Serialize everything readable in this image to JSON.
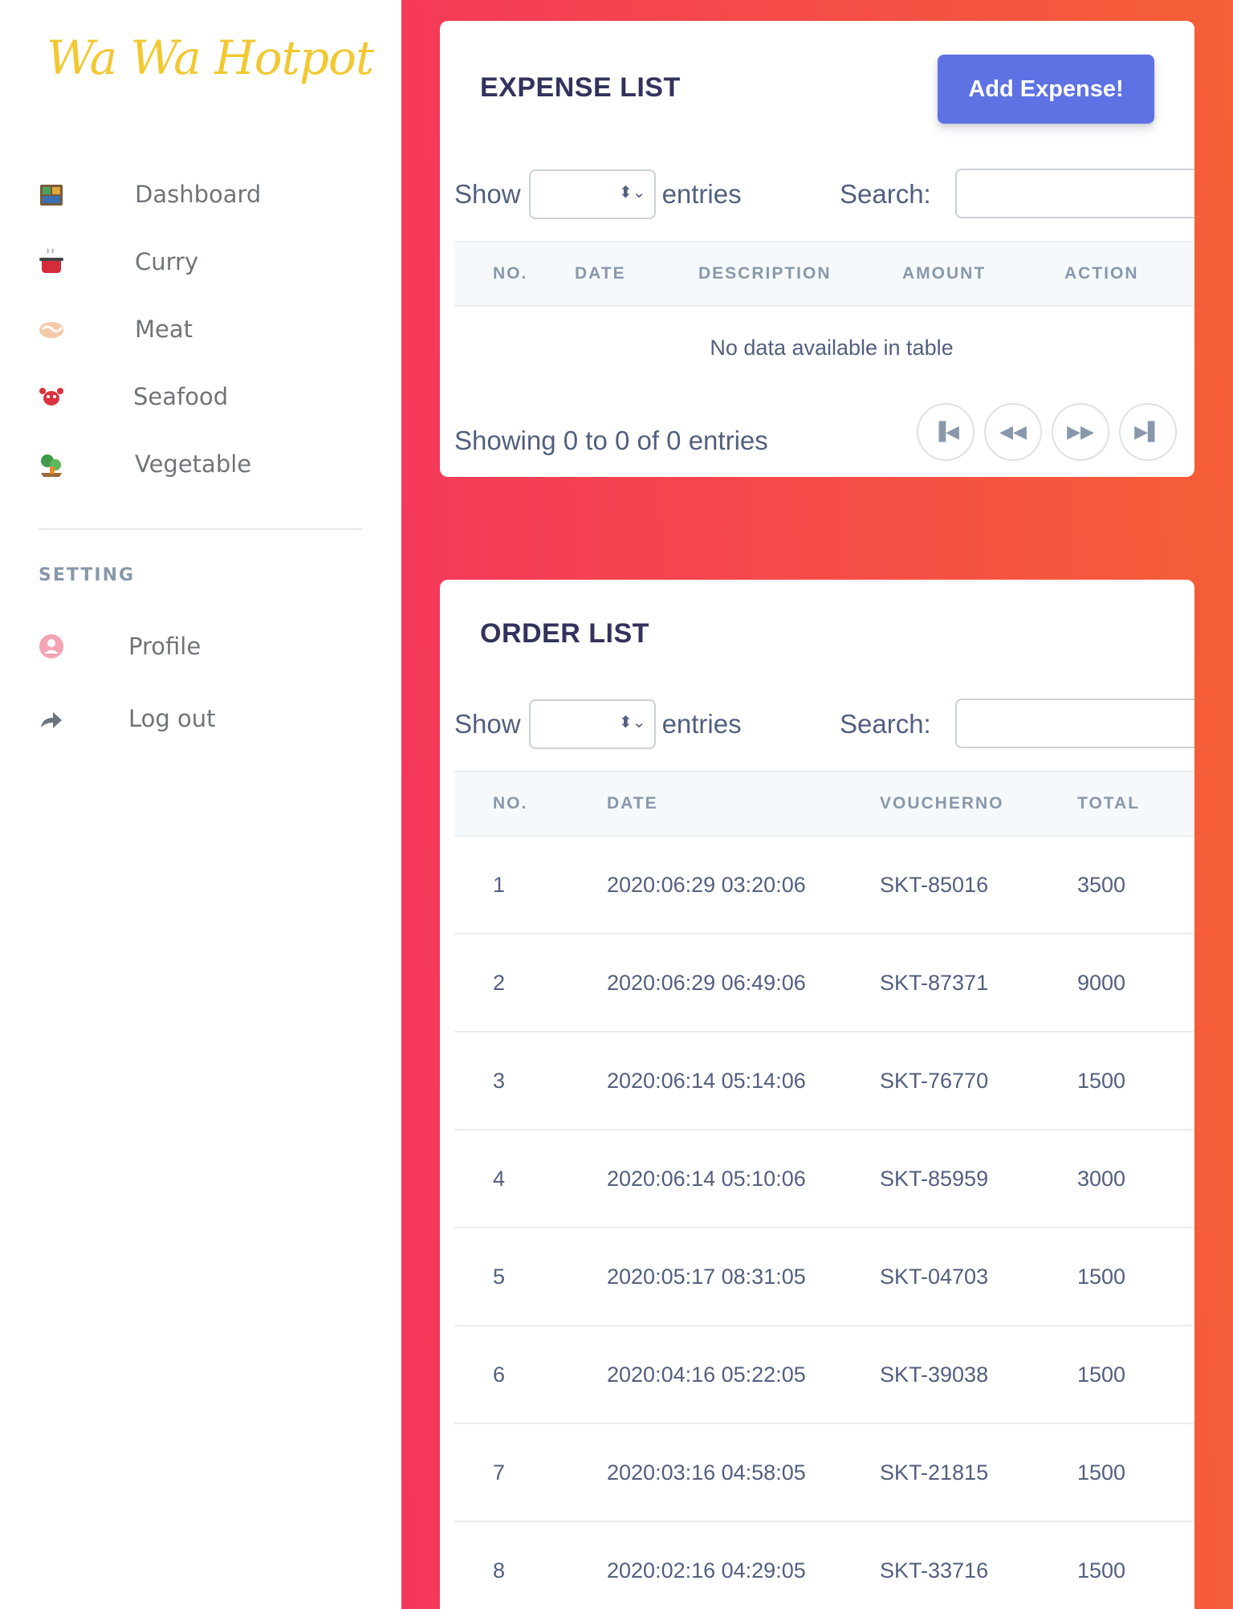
{
  "sidebar": {
    "brand": "Wa Wa Hotpot",
    "nav": [
      {
        "label": "Dashboard",
        "icon": "dashboard-icon"
      },
      {
        "label": "Curry",
        "icon": "curry-pot-icon"
      },
      {
        "label": "Meat",
        "icon": "meat-icon"
      },
      {
        "label": "Seafood",
        "icon": "seafood-icon"
      },
      {
        "label": "Vegetable",
        "icon": "vegetable-icon"
      }
    ],
    "setting_heading": "SETTING",
    "settings": [
      {
        "label": "Profile",
        "icon": "profile-icon"
      },
      {
        "label": "Log out",
        "icon": "logout-icon"
      }
    ]
  },
  "expense": {
    "title": "EXPENSE LIST",
    "add_button": "Add Expense!",
    "show_label": "Show",
    "entries_label": "entries",
    "search_label": "Search:",
    "columns": [
      "NO.",
      "DATE",
      "DESCRIPTION",
      "AMOUNT",
      "ACTION"
    ],
    "empty_message": "No data available in table",
    "info": "Showing 0 to 0 of 0 entries"
  },
  "orders": {
    "title": "ORDER LIST",
    "show_label": "Show",
    "entries_label": "entries",
    "search_label": "Search:",
    "columns": [
      "NO.",
      "DATE",
      "VOUCHERNO",
      "TOTAL"
    ],
    "rows": [
      {
        "no": "1",
        "date": "2020:06:29 03:20:06",
        "voucher": "SKT-85016",
        "total": "3500"
      },
      {
        "no": "2",
        "date": "2020:06:29 06:49:06",
        "voucher": "SKT-87371",
        "total": "9000"
      },
      {
        "no": "3",
        "date": "2020:06:14 05:14:06",
        "voucher": "SKT-76770",
        "total": "1500"
      },
      {
        "no": "4",
        "date": "2020:06:14 05:10:06",
        "voucher": "SKT-85959",
        "total": "3000"
      },
      {
        "no": "5",
        "date": "2020:05:17 08:31:05",
        "voucher": "SKT-04703",
        "total": "1500"
      },
      {
        "no": "6",
        "date": "2020:04:16 05:22:05",
        "voucher": "SKT-39038",
        "total": "1500"
      },
      {
        "no": "7",
        "date": "2020:03:16 04:58:05",
        "voucher": "SKT-21815",
        "total": "1500"
      },
      {
        "no": "8",
        "date": "2020:02:16 04:29:05",
        "voucher": "SKT-33716",
        "total": "1500"
      }
    ]
  },
  "colors": {
    "brand": "#f2c832",
    "primary": "#5e72e4",
    "gradient_start": "#f5365c",
    "gradient_end": "#f56036"
  }
}
